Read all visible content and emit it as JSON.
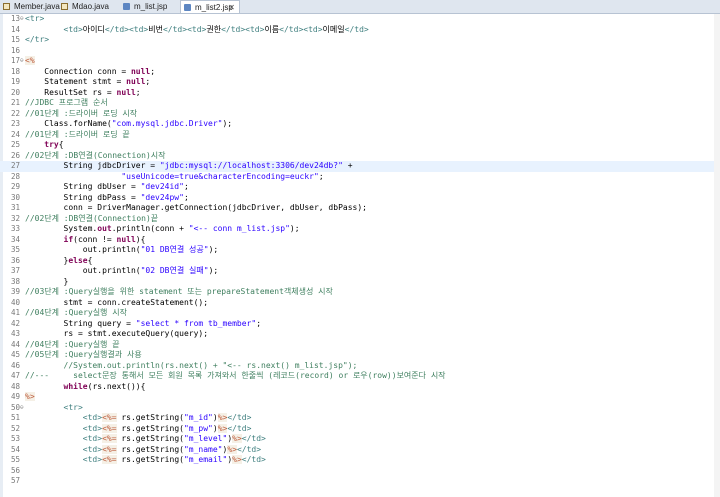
{
  "tabs": [
    {
      "label": "Member.java",
      "icon": "java-file-icon"
    },
    {
      "label": "Mdao.java",
      "icon": "java-file-icon"
    },
    {
      "label": "m_list.jsp",
      "icon": "jsp-file-icon"
    },
    {
      "label": "m_list2.jsp",
      "icon": "jsp-file-icon",
      "active": true,
      "close": "✕"
    }
  ],
  "colors": {
    "tag": "#3f7f7f",
    "keyword": "#7f0055",
    "string": "#2a00ff",
    "comment": "#3f7f5f",
    "scriptlet": "#bf5f3f",
    "text": "#000000",
    "line_highlight": "#e8f2fe"
  },
  "lines": [
    {
      "n": "13",
      "fold": "⊖",
      "t": [
        [
          "<tr>",
          "tag"
        ]
      ]
    },
    {
      "n": "14",
      "t": [
        [
          "        ",
          ""
        ],
        [
          "<td>",
          "tag"
        ],
        [
          "아이디",
          ""
        ],
        [
          "</td><td>",
          "tag"
        ],
        [
          "비번",
          ""
        ],
        [
          "</td><td>",
          "tag"
        ],
        [
          "권한",
          ""
        ],
        [
          "</td><td>",
          "tag"
        ],
        [
          "이름",
          ""
        ],
        [
          "</td><td>",
          "tag"
        ],
        [
          "이메일",
          ""
        ],
        [
          "</td>",
          "tag"
        ]
      ]
    },
    {
      "n": "15",
      "t": [
        [
          "</tr>",
          "tag"
        ]
      ]
    },
    {
      "n": "16",
      "t": []
    },
    {
      "n": "17",
      "fold": "⊖",
      "t": [
        [
          "<%",
          "scriptlet"
        ]
      ]
    },
    {
      "n": "18",
      "t": [
        [
          "    Connection conn = ",
          ""
        ],
        [
          "null",
          "keyword"
        ],
        [
          ";",
          ""
        ]
      ]
    },
    {
      "n": "19",
      "t": [
        [
          "    Statement stmt = ",
          ""
        ],
        [
          "null",
          "keyword"
        ],
        [
          ";",
          ""
        ]
      ]
    },
    {
      "n": "20",
      "t": [
        [
          "    ResultSet rs = ",
          ""
        ],
        [
          "null",
          "keyword"
        ],
        [
          ";",
          ""
        ]
      ]
    },
    {
      "n": "21",
      "t": [
        [
          "//JDBC 프로그램 순서",
          "comment"
        ]
      ]
    },
    {
      "n": "22",
      "t": [
        [
          "//01단계 :드라이버 로딩 시작",
          "comment"
        ]
      ]
    },
    {
      "n": "23",
      "t": [
        [
          "    Class.forName(",
          ""
        ],
        [
          "\"com.mysql.jdbc.Driver\"",
          "string"
        ],
        [
          ");",
          ""
        ]
      ]
    },
    {
      "n": "24",
      "t": [
        [
          "//01단계 :드라이버 로딩 끝",
          "comment"
        ]
      ]
    },
    {
      "n": "25",
      "t": [
        [
          "    ",
          ""
        ],
        [
          "try",
          "keyword"
        ],
        [
          "{",
          ""
        ]
      ]
    },
    {
      "n": "26",
      "t": [
        [
          "//02단계 :DB연결(Connection)시작",
          "comment"
        ]
      ]
    },
    {
      "n": "27",
      "hl": true,
      "t": [
        [
          "        String jdbcDriver = ",
          ""
        ],
        [
          "\"jdbc:mysql://localhost:3306/dev24db?\"",
          "string"
        ],
        [
          " +",
          ""
        ]
      ]
    },
    {
      "n": "28",
      "t": [
        [
          "                    ",
          ""
        ],
        [
          "\"useUnicode=true&characterEncoding=euckr\"",
          "string"
        ],
        [
          ";",
          ""
        ]
      ]
    },
    {
      "n": "29",
      "t": [
        [
          "        String dbUser = ",
          ""
        ],
        [
          "\"dev24id\"",
          "string"
        ],
        [
          ";",
          ""
        ]
      ]
    },
    {
      "n": "30",
      "t": [
        [
          "        String dbPass = ",
          ""
        ],
        [
          "\"dev24pw\"",
          "string"
        ],
        [
          ";",
          ""
        ]
      ]
    },
    {
      "n": "31",
      "t": [
        [
          "        conn = DriverManager.getConnection(jdbcDriver, dbUser, dbPass);",
          ""
        ]
      ]
    },
    {
      "n": "32",
      "t": [
        [
          "//02단계 :DB연결(Connection)끝",
          "comment"
        ]
      ]
    },
    {
      "n": "33",
      "t": [
        [
          "        System.",
          ""
        ],
        [
          "out",
          "keyword"
        ],
        [
          ".println(conn + ",
          ""
        ],
        [
          "\"<-- conn m_list.jsp\"",
          "string"
        ],
        [
          ");",
          ""
        ]
      ]
    },
    {
      "n": "34",
      "t": [
        [
          "        ",
          ""
        ],
        [
          "if",
          "keyword"
        ],
        [
          "(conn != ",
          ""
        ],
        [
          "null",
          "keyword"
        ],
        [
          "){",
          ""
        ]
      ]
    },
    {
      "n": "35",
      "t": [
        [
          "            out.println(",
          ""
        ],
        [
          "\"01 DB연결 성공\"",
          "string"
        ],
        [
          ");",
          ""
        ]
      ]
    },
    {
      "n": "36",
      "t": [
        [
          "        }",
          ""
        ],
        [
          "else",
          "keyword"
        ],
        [
          "{",
          ""
        ]
      ]
    },
    {
      "n": "37",
      "t": [
        [
          "            out.println(",
          ""
        ],
        [
          "\"02 DB연결 실패\"",
          "string"
        ],
        [
          ");",
          ""
        ]
      ]
    },
    {
      "n": "38",
      "t": [
        [
          "        }",
          ""
        ]
      ]
    },
    {
      "n": "39",
      "t": [
        [
          "//03단계 :Query실행을 위한 statement 또는 prepareStatement객체생성 시작",
          "comment"
        ]
      ]
    },
    {
      "n": "40",
      "t": [
        [
          "        stmt = conn.createStatement();",
          ""
        ]
      ]
    },
    {
      "n": "41",
      "t": [
        [
          "//04단계 :Query실행 시작",
          "comment"
        ]
      ]
    },
    {
      "n": "42",
      "t": [
        [
          "        String query = ",
          ""
        ],
        [
          "\"select * from tb_member\"",
          "string"
        ],
        [
          ";",
          ""
        ]
      ]
    },
    {
      "n": "43",
      "t": [
        [
          "        rs = stmt.executeQuery(query);",
          ""
        ]
      ]
    },
    {
      "n": "44",
      "t": [
        [
          "//04단계 :Query실행 끝",
          "comment"
        ]
      ]
    },
    {
      "n": "45",
      "t": [
        [
          "//05단계 :Query실행결과 사용",
          "comment"
        ]
      ]
    },
    {
      "n": "46",
      "t": [
        [
          "        //System.out.println(rs.next() + \"<-- rs.next() m_list.jsp\");",
          "comment"
        ]
      ]
    },
    {
      "n": "47",
      "t": [
        [
          "//---     select문장 통해서 모든 회원 목록 가져와서 한줄씩 (레코드(record) or 로우(row))보여준다 시작",
          "comment"
        ]
      ]
    },
    {
      "n": "48",
      "t": [
        [
          "        ",
          ""
        ],
        [
          "while",
          "keyword"
        ],
        [
          "(rs.next()){",
          ""
        ]
      ]
    },
    {
      "n": "49",
      "t": [
        [
          "%>",
          "scriptlet"
        ]
      ]
    },
    {
      "n": "50",
      "fold": "⊖",
      "t": [
        [
          "        ",
          ""
        ],
        [
          "<tr>",
          "tag"
        ]
      ]
    },
    {
      "n": "51",
      "t": [
        [
          "            ",
          ""
        ],
        [
          "<td>",
          "tag"
        ],
        [
          "<%=",
          "scriptlet"
        ],
        [
          " rs.getString(",
          ""
        ],
        [
          "\"m_id\"",
          "string"
        ],
        [
          ")",
          ""
        ],
        [
          "%>",
          "scriptlet"
        ],
        [
          "</td>",
          "tag"
        ]
      ]
    },
    {
      "n": "52",
      "t": [
        [
          "            ",
          ""
        ],
        [
          "<td>",
          "tag"
        ],
        [
          "<%=",
          "scriptlet"
        ],
        [
          " rs.getString(",
          ""
        ],
        [
          "\"m_pw\"",
          "string"
        ],
        [
          ")",
          ""
        ],
        [
          "%>",
          "scriptlet"
        ],
        [
          "</td>",
          "tag"
        ]
      ]
    },
    {
      "n": "53",
      "t": [
        [
          "            ",
          ""
        ],
        [
          "<td>",
          "tag"
        ],
        [
          "<%=",
          "scriptlet"
        ],
        [
          " rs.getString(",
          ""
        ],
        [
          "\"m_level\"",
          "string"
        ],
        [
          ")",
          ""
        ],
        [
          "%>",
          "scriptlet"
        ],
        [
          "</td>",
          "tag"
        ]
      ]
    },
    {
      "n": "54",
      "t": [
        [
          "            ",
          ""
        ],
        [
          "<td>",
          "tag"
        ],
        [
          "<%=",
          "scriptlet"
        ],
        [
          " rs.getString(",
          ""
        ],
        [
          "\"m_name\"",
          "string"
        ],
        [
          ")",
          ""
        ],
        [
          "%>",
          "scriptlet"
        ],
        [
          "</td>",
          "tag"
        ]
      ]
    },
    {
      "n": "55",
      "t": [
        [
          "            ",
          ""
        ],
        [
          "<td>",
          "tag"
        ],
        [
          "<%=",
          "scriptlet"
        ],
        [
          " rs.getString(",
          ""
        ],
        [
          "\"m_email\"",
          "string"
        ],
        [
          ")",
          ""
        ],
        [
          "%>",
          "scriptlet"
        ],
        [
          "</td>",
          "tag"
        ]
      ]
    },
    {
      "n": "56",
      "t": []
    },
    {
      "n": "57",
      "t": []
    }
  ]
}
